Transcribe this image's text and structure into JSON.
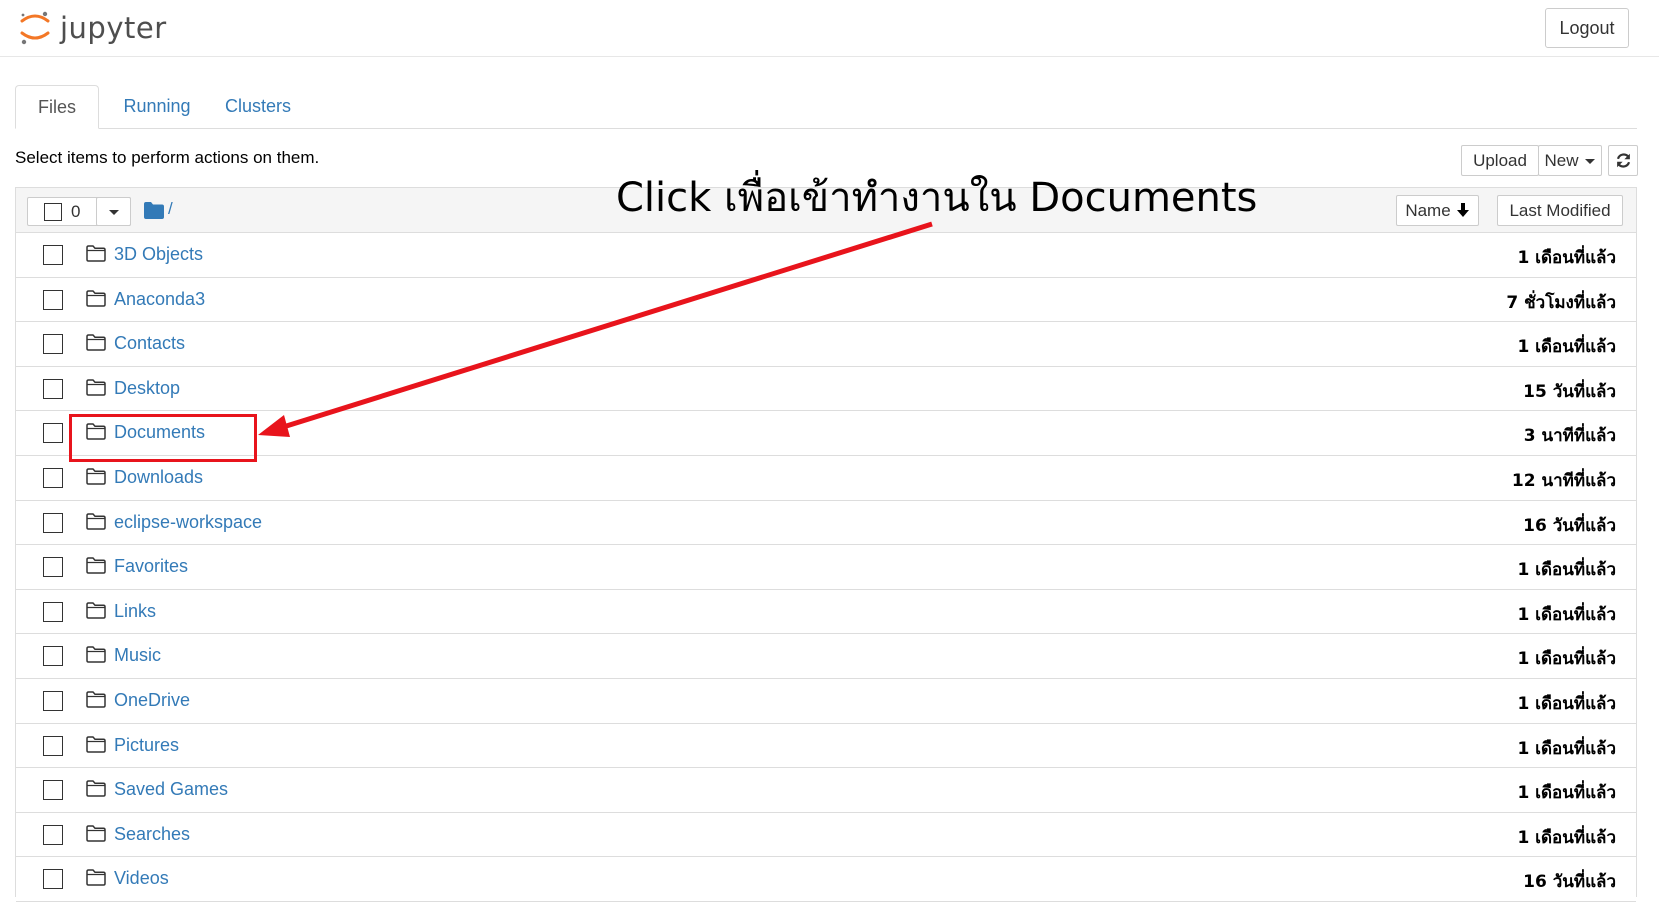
{
  "header": {
    "logo_text": "jupyter",
    "logout_label": "Logout"
  },
  "tabs": [
    {
      "label": "Files",
      "active": true
    },
    {
      "label": "Running",
      "active": false
    },
    {
      "label": "Clusters",
      "active": false
    }
  ],
  "toolbar": {
    "hint": "Select items to perform actions on them.",
    "upload_label": "Upload",
    "new_label": "New",
    "selected_count": "0",
    "path": "/",
    "sort_name_label": "Name",
    "sort_modified_label": "Last Modified"
  },
  "files": [
    {
      "name": "3D Objects",
      "modified": "1 เดือนที่แล้ว"
    },
    {
      "name": "Anaconda3",
      "modified": "7 ชั่วโมงที่แล้ว"
    },
    {
      "name": "Contacts",
      "modified": "1 เดือนที่แล้ว"
    },
    {
      "name": "Desktop",
      "modified": "15 วันที่แล้ว"
    },
    {
      "name": "Documents",
      "modified": "3 นาทีที่แล้ว"
    },
    {
      "name": "Downloads",
      "modified": "12 นาทีที่แล้ว"
    },
    {
      "name": "eclipse-workspace",
      "modified": "16 วันที่แล้ว"
    },
    {
      "name": "Favorites",
      "modified": "1 เดือนที่แล้ว"
    },
    {
      "name": "Links",
      "modified": "1 เดือนที่แล้ว"
    },
    {
      "name": "Music",
      "modified": "1 เดือนที่แล้ว"
    },
    {
      "name": "OneDrive",
      "modified": "1 เดือนที่แล้ว"
    },
    {
      "name": "Pictures",
      "modified": "1 เดือนที่แล้ว"
    },
    {
      "name": "Saved Games",
      "modified": "1 เดือนที่แล้ว"
    },
    {
      "name": "Searches",
      "modified": "1 เดือนที่แล้ว"
    },
    {
      "name": "Videos",
      "modified": "16 วันที่แล้ว"
    }
  ],
  "annotation": {
    "text": "Click เพื่อเข้าทำงานใน Documents",
    "color": "#e8141c"
  },
  "colors": {
    "link": "#337ab7",
    "logo_orange": "#f37726"
  }
}
